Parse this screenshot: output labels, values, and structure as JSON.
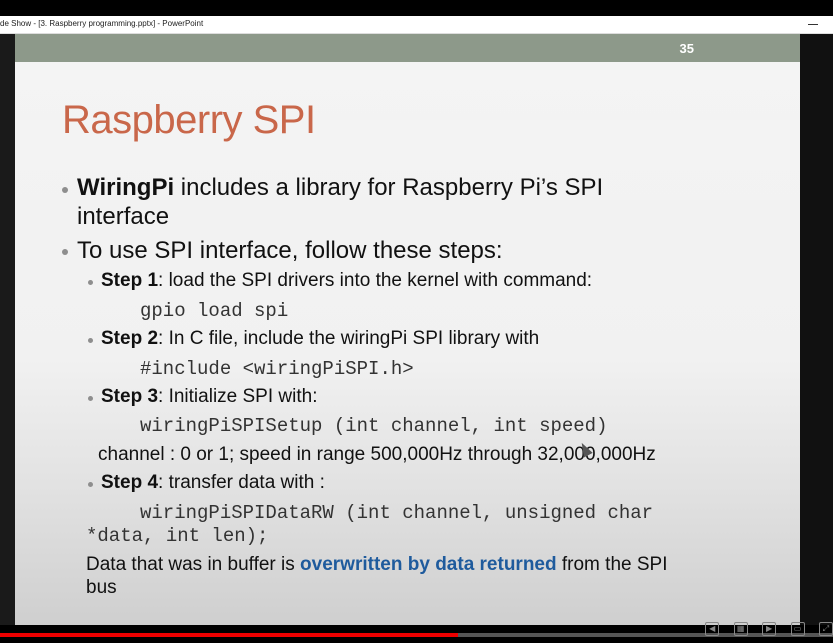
{
  "window": {
    "title": "de Show - [3. Raspberry programming.pptx] - PowerPoint"
  },
  "slide": {
    "number": "35",
    "title": "Raspberry SPI",
    "bullet1_bold": "WiringPi",
    "bullet1_line1": " includes a library for Raspberry Pi’s SPI",
    "bullet1_line2": "interface",
    "bullet2": "To use SPI interface, follow these steps:",
    "step1_label": "Step 1",
    "step1_text": ": load the SPI drivers into the kernel with command:",
    "step1_code": "gpio load spi",
    "step2_label": "Step 2",
    "step2_text": ": In C file, include the wiringPi SPI library with",
    "step2_code": "#include <wiringPiSPI.h>",
    "step3_label": "Step 3",
    "step3_text": ": Initialize SPI with:",
    "step3_code": "wiringPiSPISetup (int channel, int speed)",
    "step3_note": "channel : 0 or 1;   speed in range 500,000Hz through 32,000,000Hz",
    "step4_label": "Step 4",
    "step4_text": ": transfer data with :",
    "step4_code_line1": "wiringPiSPIDataRW (int channel, unsigned char",
    "step4_code_line2": "*data, int len);",
    "final_pre": "Data that was in buffer is ",
    "final_hl": "overwritten by data returned",
    "final_post": " from the SPI",
    "final_line2": "bus"
  },
  "player": {
    "progress": 0.55
  },
  "icons": [
    "minimize-icon",
    "prev-slide-icon",
    "slide-sorter-icon",
    "next-slide-icon",
    "normal-view-icon",
    "fit-icon"
  ],
  "colors": {
    "title": "#c9674a",
    "header_bar": "#8d998a",
    "highlight": "#1f5b9d",
    "progress": "#e00000"
  }
}
